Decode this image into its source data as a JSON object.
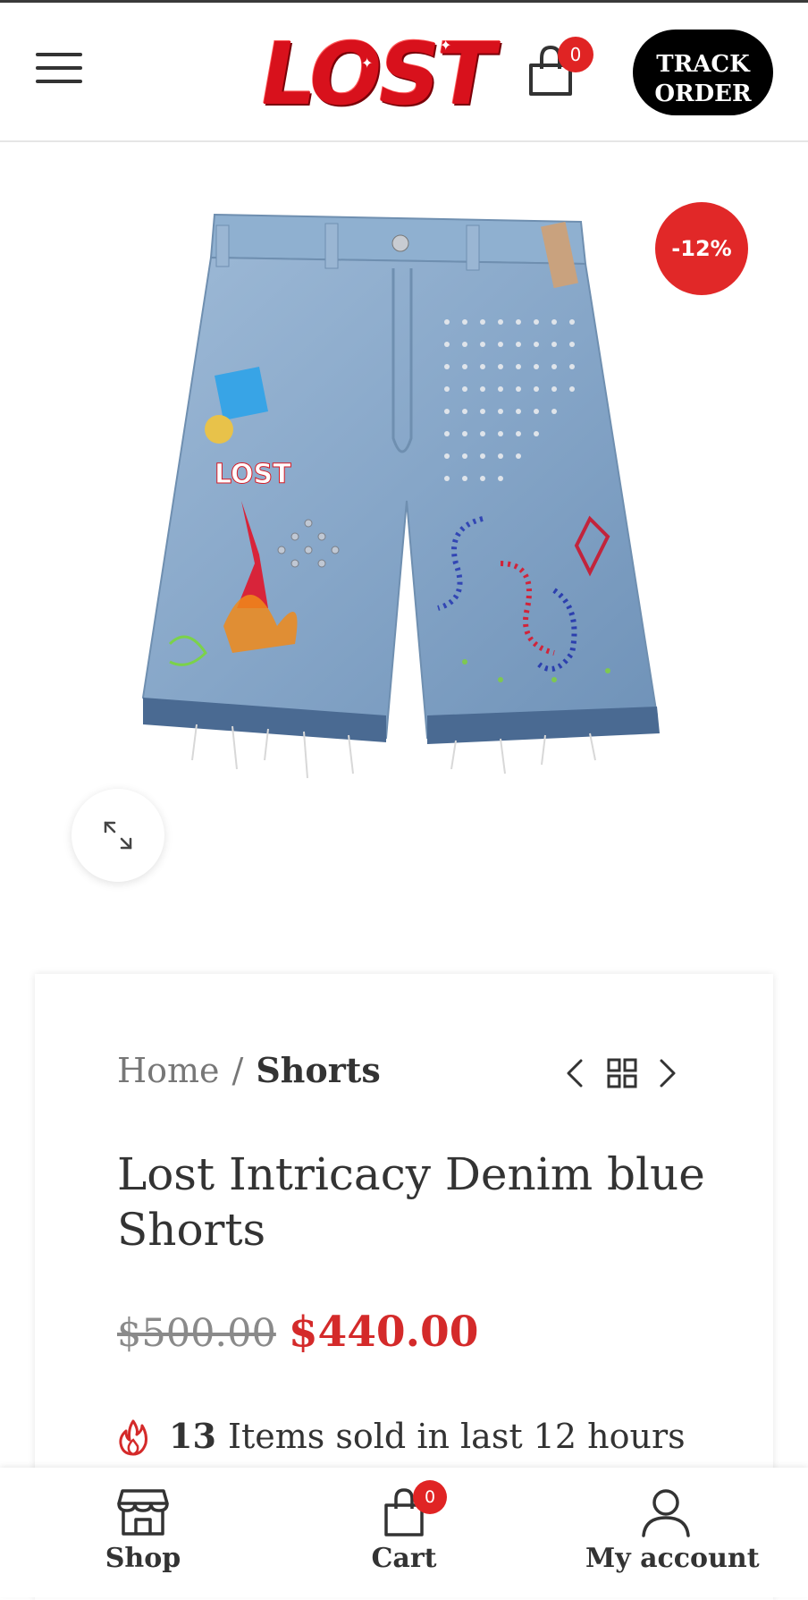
{
  "header": {
    "logo_text": "LOST",
    "cart_count": "0",
    "track_order_line1": "TRACK",
    "track_order_line2": "ORDER"
  },
  "product": {
    "image_description_icon": "denim-shorts-image",
    "discount_badge": "-12%",
    "breadcrumb": {
      "home": "Home",
      "separator": "/",
      "current": "Shorts"
    },
    "title": "Lost Intricacy Denim blue Shorts",
    "old_price": "$500.00",
    "new_price": "$440.00",
    "sold_count": "13",
    "sold_text": "Items sold in last 12 hours"
  },
  "bottom_nav": {
    "shop_label": "Shop",
    "cart_label": "Cart",
    "cart_count": "0",
    "account_label": "My account"
  },
  "colors": {
    "accent_red": "#d42a2a",
    "badge_red": "#e02424",
    "text_dark": "#333333",
    "text_muted": "#777777"
  }
}
